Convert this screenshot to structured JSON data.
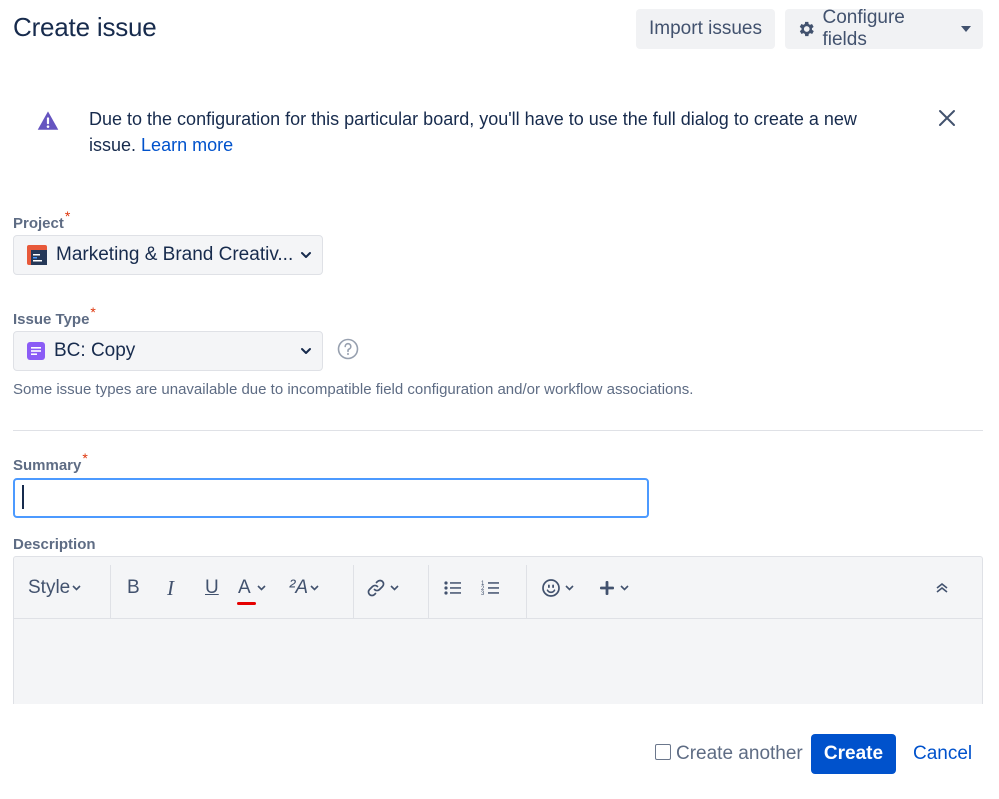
{
  "header": {
    "title": "Create issue",
    "import_label": "Import issues",
    "configure_label": "Configure fields"
  },
  "banner": {
    "message": "Due to the configuration for this particular board, you'll have to use the full dialog to create a new issue.",
    "link_label": "Learn more",
    "warning_color": "#6554c0"
  },
  "project": {
    "label": "Project",
    "required_mark": "*",
    "value": "Marketing & Brand Creativ..."
  },
  "issue_type": {
    "label": "Issue Type",
    "required_mark": "*",
    "value": "BC: Copy",
    "note": "Some issue types are unavailable due to incompatible field configuration and/or workflow associations."
  },
  "summary": {
    "label": "Summary",
    "required_mark": "*",
    "value": ""
  },
  "description": {
    "label": "Description",
    "toolbar": {
      "style_label": "Style",
      "bold": "B",
      "italic": "I",
      "underline": "U",
      "text_color": "A",
      "more_formatting": "²A"
    }
  },
  "footer": {
    "create_another_label": "Create another",
    "create_label": "Create",
    "cancel_label": "Cancel"
  },
  "colors": {
    "primary": "#0052cc",
    "required": "#de350b",
    "focus": "#4c9aff",
    "text_color_underline": "#e50000"
  }
}
